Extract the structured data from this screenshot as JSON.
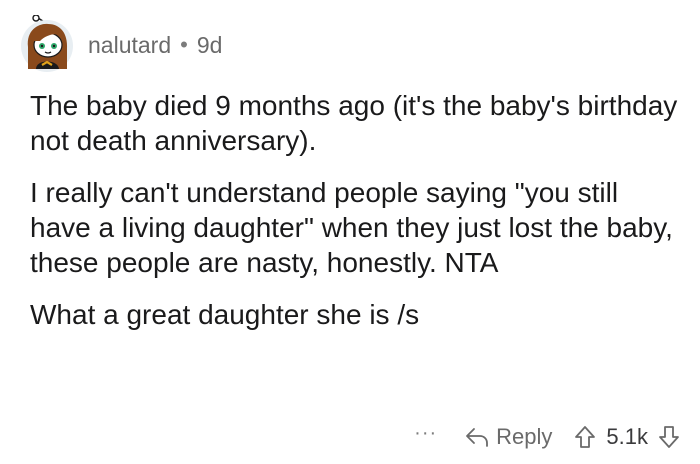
{
  "comment": {
    "author": "nalutard",
    "separator": "•",
    "age": "9d",
    "avatar_icon": "snoo-avatar-icon",
    "paragraphs": [
      "The baby died 9 months ago (it's the baby's birthday not death anniversary).",
      "I really can't understand people saying \"you still have a living daughter\" when they just lost the baby, these people are nasty, honestly. NTA",
      "What a great daughter she is /s"
    ]
  },
  "actions": {
    "more_label": "···",
    "reply_label": "Reply",
    "reply_icon": "reply-arrow-icon",
    "upvote_icon": "upvote-arrow-icon",
    "score": "5.1k",
    "downvote_icon": "downvote-arrow-icon"
  },
  "colors": {
    "text": "#1a1a1b",
    "meta": "#6a6a6a",
    "avatar_bg": "#e8eef2",
    "hair": "#8a4a1c"
  }
}
